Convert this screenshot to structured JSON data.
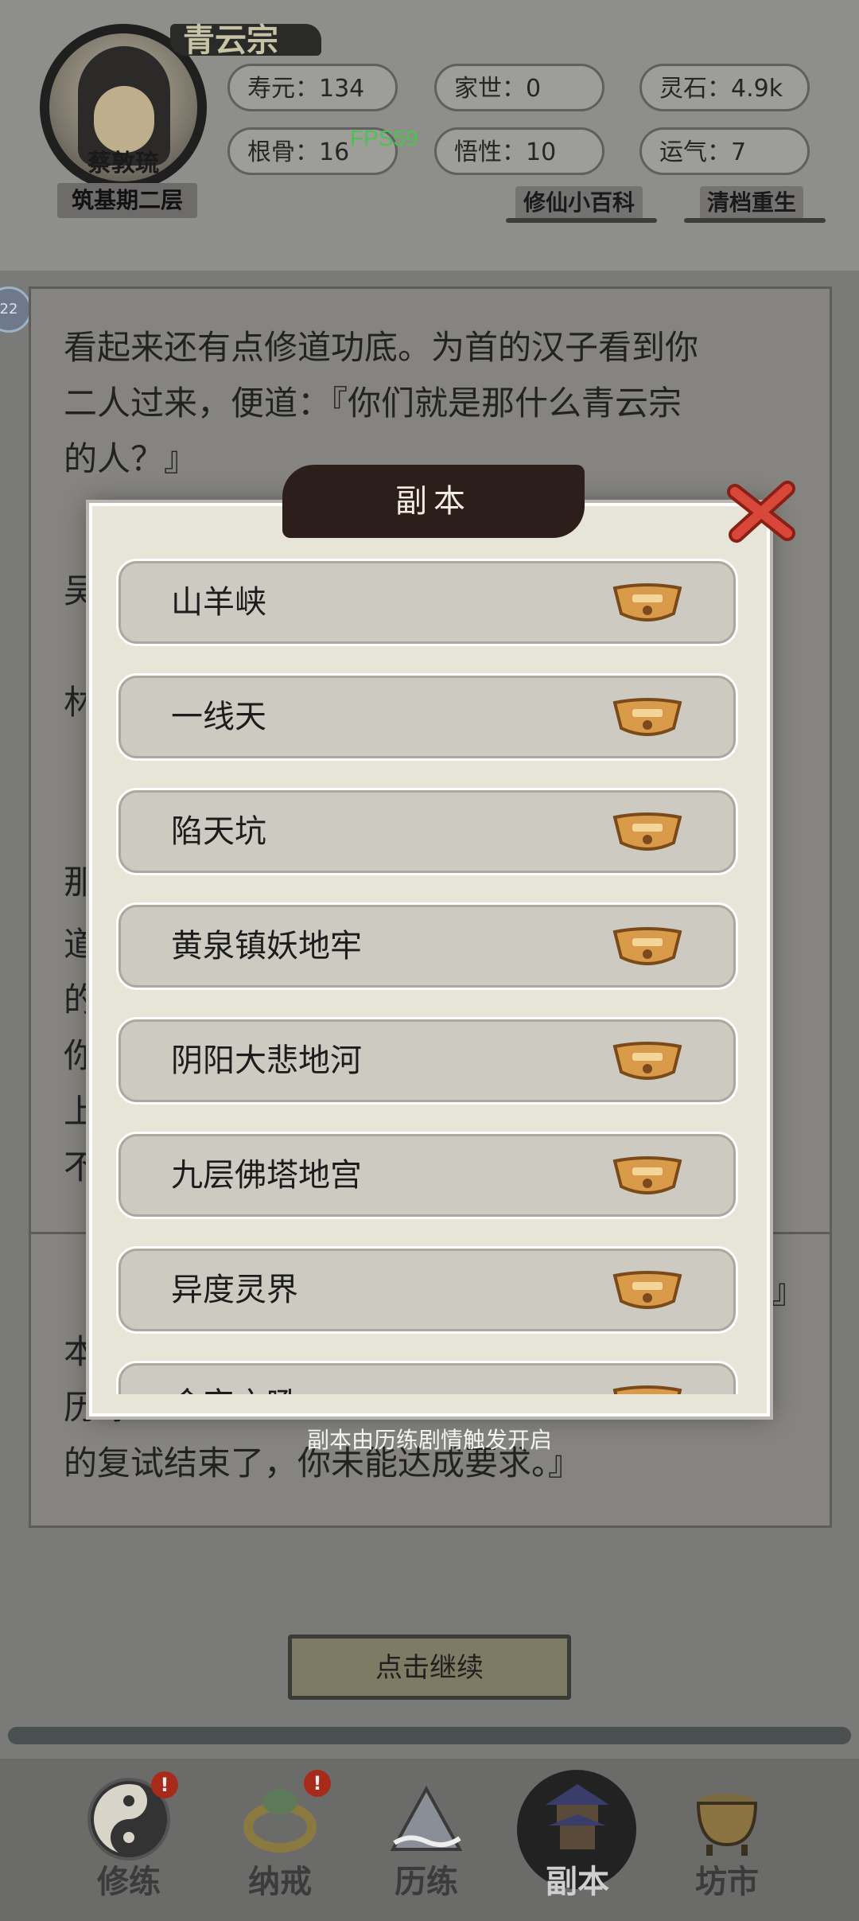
{
  "header": {
    "sect": "青云宗",
    "character_name": "蔡敦琉",
    "realm": "筑基期二层",
    "stats": [
      {
        "label": "寿元：",
        "value": "134"
      },
      {
        "label": "家世：",
        "value": "0"
      },
      {
        "label": "灵石：",
        "value": "4.9k"
      },
      {
        "label": "根骨：",
        "value": "16"
      },
      {
        "label": "悟性：",
        "value": "10"
      },
      {
        "label": "运气：",
        "value": "7"
      }
    ],
    "links": [
      "修仙小百科",
      "清档重生"
    ],
    "fps": "FPS59",
    "side_badge": "22"
  },
  "story": {
    "lines": [
      "看起来还有点修道功底。为首的汉子看到你",
      "二人过来，便道：『你们就是那什么青云宗",
      "的人？』",
      "的复试结束了，你未能达成要求。』"
    ],
    "fragments": [
      "吴",
      "林",
      "那",
      "道",
      "的",
      "你",
      "上",
      "不",
      "本",
      "历练",
      "』"
    ],
    "continue_label": "点击继续"
  },
  "modal": {
    "title": "副本",
    "dungeons": [
      "山羊峡",
      "一线天",
      "陷天坑",
      "黄泉镇妖地牢",
      "阴阳大悲地河",
      "九层佛塔地宫",
      "异度灵界",
      "金宫之吼"
    ],
    "hint": "副本由历练剧情触发开启",
    "lock_icon": "lock-icon",
    "close_icon": "close-icon"
  },
  "nav": {
    "items": [
      {
        "label": "修练",
        "icon": "yin-yang-icon",
        "alert": "!"
      },
      {
        "label": "纳戒",
        "icon": "ring-icon",
        "alert": "!"
      },
      {
        "label": "历练",
        "icon": "mountain-icon",
        "alert": ""
      },
      {
        "label": "副本",
        "icon": "pagoda-icon",
        "alert": ""
      },
      {
        "label": "坊市",
        "icon": "cauldron-icon",
        "alert": ""
      }
    ]
  },
  "colors": {
    "accent_lock": "#d99a4a",
    "close_red": "#c0392b",
    "fps_green": "#4ec24e"
  }
}
